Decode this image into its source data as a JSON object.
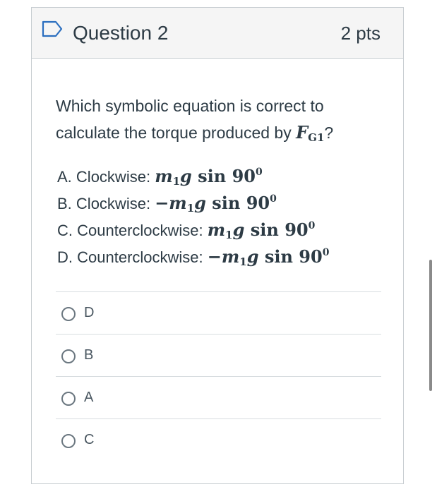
{
  "question": {
    "title": "Question 2",
    "points": "2 pts",
    "prompt_text": "Which symbolic equation is correct to calculate the torque produced by",
    "prompt_symbol": "F",
    "prompt_symbol_sub": "G1",
    "prompt_end": "?"
  },
  "choices": [
    {
      "letter": "A.",
      "direction": "Clockwise:",
      "sign": "",
      "m": "m",
      "m_sub": "1",
      "g": "g",
      "sin": "sin",
      "angle": "90",
      "exp": "0"
    },
    {
      "letter": "B.",
      "direction": "Clockwise:",
      "sign": "−",
      "m": "m",
      "m_sub": "1",
      "g": "g",
      "sin": "sin",
      "angle": "90",
      "exp": "0"
    },
    {
      "letter": "C.",
      "direction": "Counterclockwise:",
      "sign": "",
      "m": "m",
      "m_sub": "1",
      "g": "g",
      "sin": "sin",
      "angle": "90",
      "exp": "0"
    },
    {
      "letter": "D.",
      "direction": "Counterclockwise:",
      "sign": "−",
      "m": "m",
      "m_sub": "1",
      "g": "g",
      "sin": "sin",
      "angle": "90",
      "exp": "0"
    }
  ],
  "answers": [
    {
      "label": "D"
    },
    {
      "label": "B"
    },
    {
      "label": "A"
    },
    {
      "label": "C"
    }
  ],
  "colors": {
    "header_bg": "#f5f5f5",
    "border": "#c7cdd1",
    "text": "#2d3b45",
    "flag_icon": "#2a6ebf"
  },
  "icons": {
    "flag": "bookmark-flag-icon",
    "radio": "radio-unselected-icon"
  }
}
